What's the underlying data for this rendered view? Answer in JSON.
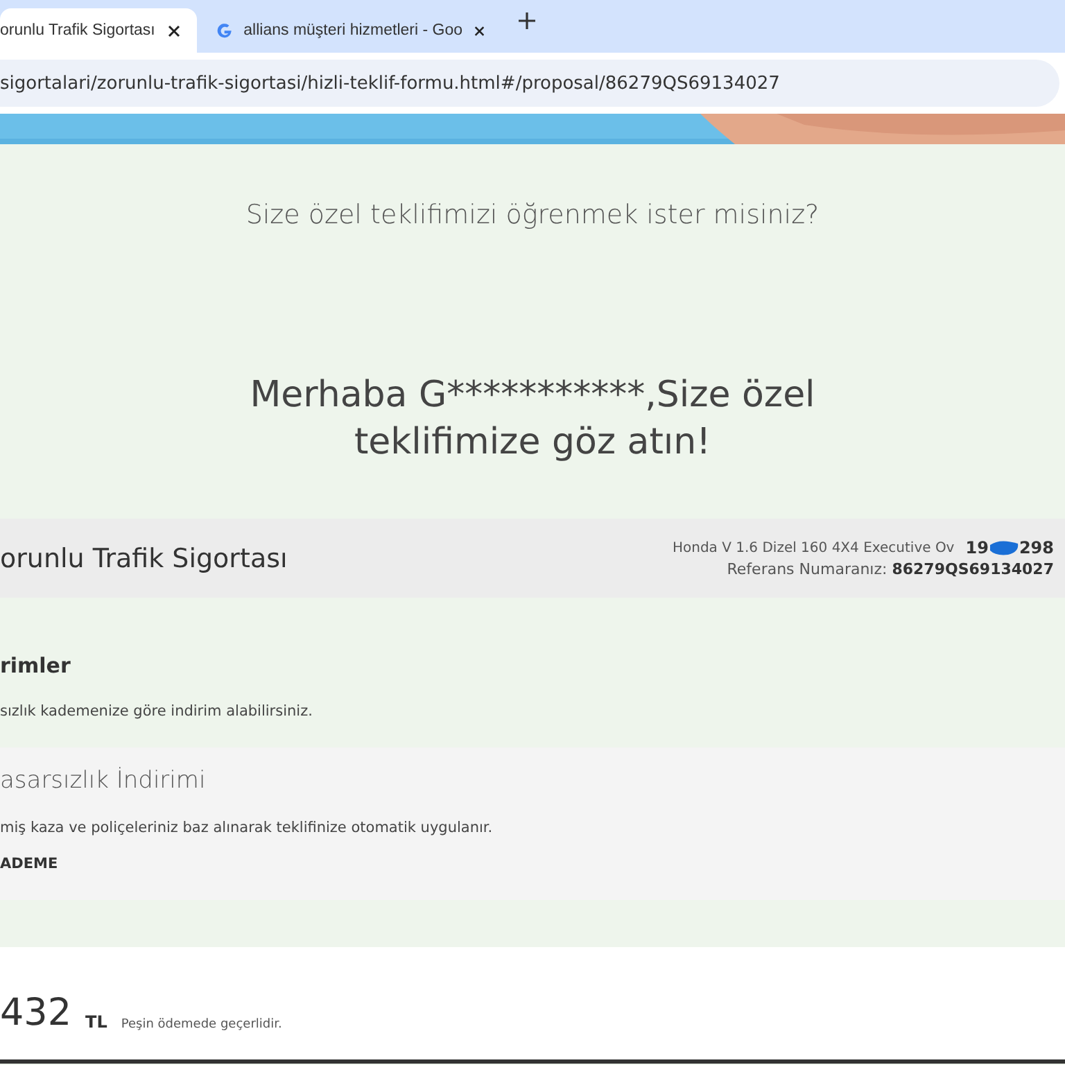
{
  "browser": {
    "tabs": [
      {
        "title": "orunlu Trafik Sigortası",
        "selected": true,
        "kind": "site"
      },
      {
        "title": "allians müşteri hizmetleri - Goo",
        "selected": false,
        "kind": "google"
      }
    ],
    "address": "sigortalari/zorunlu-trafik-sigortasi/hizli-teklif-formu.html#/proposal/86279QS69134027"
  },
  "intro": "Size özel teklifimizi öğrenmek ister misiniz?",
  "greeting": "Merhaba G***********,Size özel teklifimize göz atın!",
  "product_bar": {
    "title": "orunlu Trafik Sigortası",
    "vehicle": "Honda V 1.6 Dizel 160 4X4 Executive Ov",
    "plate_start": "19",
    "plate_end": "298",
    "reference_label": "Referans Numaranız:",
    "reference": "86279QS69134027"
  },
  "discounts": {
    "title": "rimler",
    "text": "sızlık kademenize göre indirim alabilirsiniz.",
    "item": {
      "title": "asarsızlık İndirimi",
      "text": "miş kaza ve poliçeleriniz baz alınarak teklifinize otomatik uygulanır.",
      "level_label": "ADEME"
    }
  },
  "price": {
    "amount": "432",
    "currency": "TL",
    "note": "Peşin ödemede geçerlidir."
  }
}
